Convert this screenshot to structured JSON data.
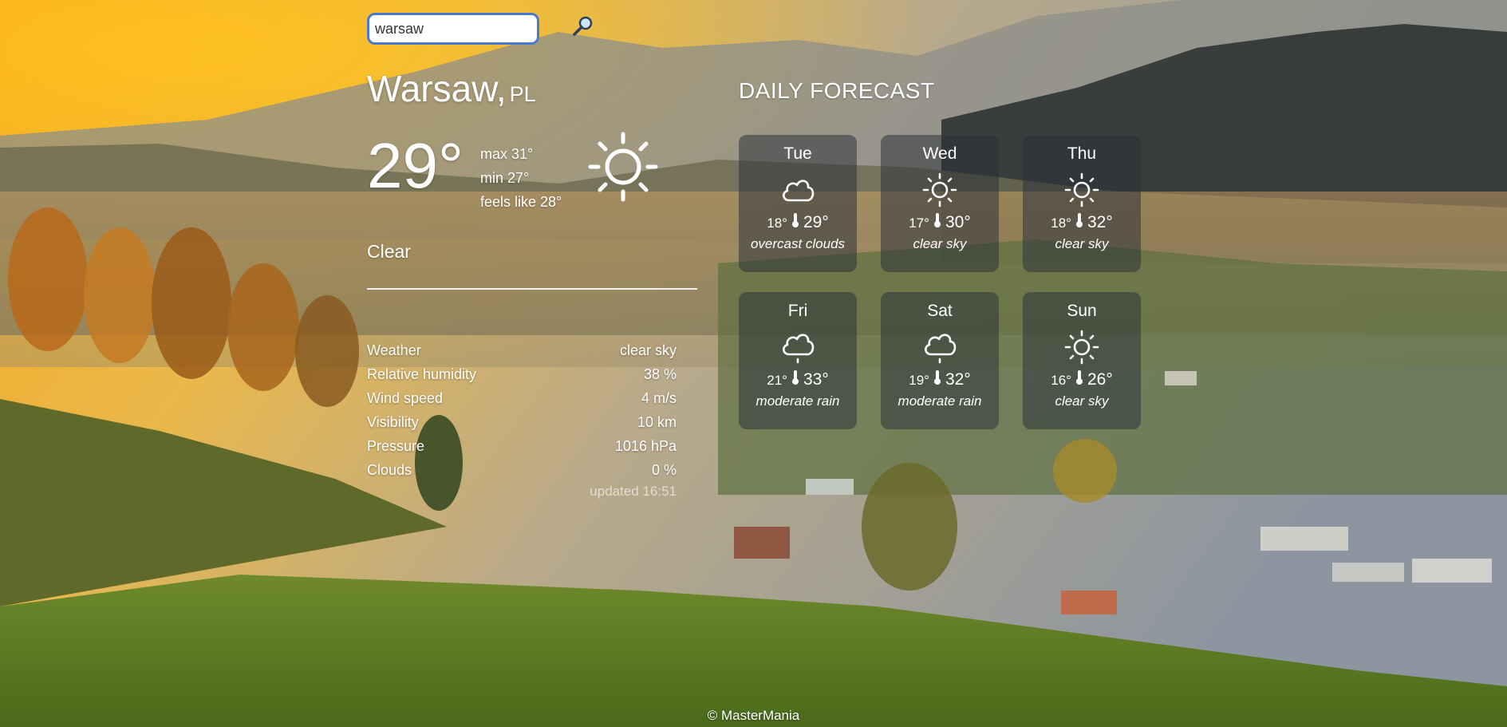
{
  "search": {
    "value": "warsaw"
  },
  "location": {
    "city": "Warsaw,",
    "country": "PL"
  },
  "current": {
    "temp": "29°",
    "max": "max 31°",
    "min": "min 27°",
    "feels": "feels like 28°",
    "condition": "Clear",
    "icon": "sun-icon"
  },
  "details": [
    {
      "label": "Weather",
      "value": "clear sky"
    },
    {
      "label": "Relative humidity",
      "value": "38 %"
    },
    {
      "label": "Wind speed",
      "value": "4 m/s"
    },
    {
      "label": "Visibility",
      "value": "10 km"
    },
    {
      "label": "Pressure",
      "value": "1016 hPa"
    },
    {
      "label": "Clouds",
      "value": "0 %"
    }
  ],
  "updated": "updated 16:51",
  "forecast": {
    "title": "DAILY FORECAST",
    "days": [
      {
        "day": "Tue",
        "min": "18°",
        "max": "29°",
        "desc": "overcast clouds",
        "icon": "cloud-icon"
      },
      {
        "day": "Wed",
        "min": "17°",
        "max": "30°",
        "desc": "clear sky",
        "icon": "sun-icon"
      },
      {
        "day": "Thu",
        "min": "18°",
        "max": "32°",
        "desc": "clear sky",
        "icon": "sun-icon"
      },
      {
        "day": "Fri",
        "min": "21°",
        "max": "33°",
        "desc": "moderate rain",
        "icon": "rain-cloud-icon"
      },
      {
        "day": "Sat",
        "min": "19°",
        "max": "32°",
        "desc": "moderate rain",
        "icon": "rain-cloud-icon"
      },
      {
        "day": "Sun",
        "min": "16°",
        "max": "26°",
        "desc": "clear sky",
        "icon": "sun-icon"
      }
    ]
  },
  "footer": "© MasterMania",
  "colors": {
    "search_border": "#4a7bd0",
    "card_bg": "#2a303a"
  }
}
